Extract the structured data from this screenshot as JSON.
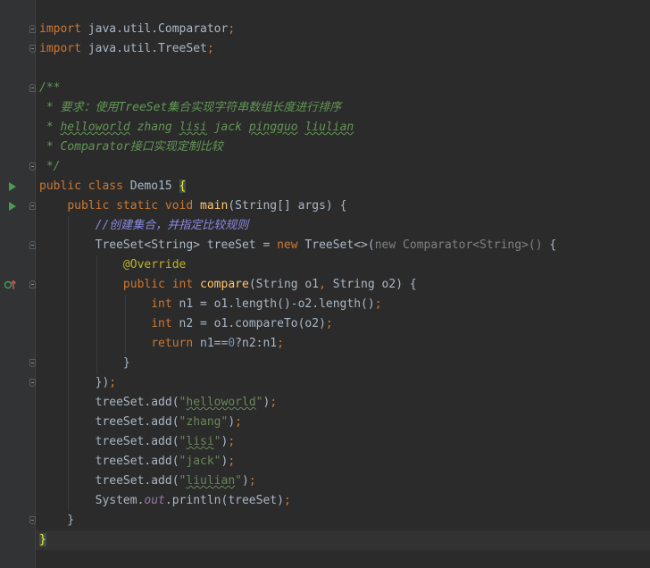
{
  "code_lines": [
    {
      "parts": [
        {
          "t": "import",
          "c": "kw"
        },
        {
          "t": " java.util.Comparator"
        },
        {
          "t": ";",
          "c": "kw"
        }
      ]
    },
    {
      "parts": [
        {
          "t": "import",
          "c": "kw"
        },
        {
          "t": " java.util.TreeSet"
        },
        {
          "t": ";",
          "c": "kw"
        }
      ]
    },
    {
      "parts": []
    },
    {
      "parts": [
        {
          "t": "/**",
          "c": "doc"
        }
      ]
    },
    {
      "parts": [
        {
          "t": " * 要求：使用TreeSet集合实现字符串数组长度进行排序",
          "c": "doc"
        }
      ]
    },
    {
      "parts": [
        {
          "t": " * ",
          "c": "doc"
        },
        {
          "t": "helloworld",
          "c": "doc typo-doc"
        },
        {
          "t": " zhang ",
          "c": "doc"
        },
        {
          "t": "lisi",
          "c": "doc typo-doc"
        },
        {
          "t": " jack ",
          "c": "doc"
        },
        {
          "t": "pingguo",
          "c": "doc typo-doc"
        },
        {
          "t": " ",
          "c": "doc"
        },
        {
          "t": "liulian",
          "c": "doc typo-doc"
        }
      ]
    },
    {
      "parts": [
        {
          "t": " * Comparator接口实现定制比较",
          "c": "doc"
        }
      ]
    },
    {
      "parts": [
        {
          "t": " */",
          "c": "doc"
        }
      ]
    },
    {
      "parts": [
        {
          "t": "public class ",
          "c": "kw"
        },
        {
          "t": "Demo15 "
        },
        {
          "t": "{",
          "c": "brace-hl"
        }
      ]
    },
    {
      "parts": [
        {
          "t": "    "
        },
        {
          "t": "public static void ",
          "c": "kw"
        },
        {
          "t": "main",
          "c": "fn"
        },
        {
          "t": "(String[] args) {"
        }
      ]
    },
    {
      "parts": [
        {
          "t": "        "
        },
        {
          "t": "//创建集合，并指定比较规则",
          "c": "linecmt"
        }
      ]
    },
    {
      "parts": [
        {
          "t": "        TreeSet<String> treeSet = "
        },
        {
          "t": "new ",
          "c": "kw"
        },
        {
          "t": "TreeSet<>("
        },
        {
          "t": "new Comparator<String>()",
          "c": "gray"
        },
        {
          "t": " {"
        }
      ]
    },
    {
      "parts": [
        {
          "t": "            "
        },
        {
          "t": "@Override",
          "c": "ann"
        }
      ]
    },
    {
      "parts": [
        {
          "t": "            "
        },
        {
          "t": "public int ",
          "c": "kw"
        },
        {
          "t": "compare",
          "c": "fn"
        },
        {
          "t": "(String o1"
        },
        {
          "t": ", ",
          "c": "kw"
        },
        {
          "t": "String o2) {"
        }
      ]
    },
    {
      "parts": [
        {
          "t": "                "
        },
        {
          "t": "int ",
          "c": "kw"
        },
        {
          "t": "n1 = o1.length()-o2.length()"
        },
        {
          "t": ";",
          "c": "kw"
        }
      ]
    },
    {
      "parts": [
        {
          "t": "                "
        },
        {
          "t": "int ",
          "c": "kw"
        },
        {
          "t": "n2 = o1.compareTo(o2)"
        },
        {
          "t": ";",
          "c": "kw"
        }
      ]
    },
    {
      "parts": [
        {
          "t": "                "
        },
        {
          "t": "return ",
          "c": "kw"
        },
        {
          "t": "n1=="
        },
        {
          "t": "0",
          "c": "num"
        },
        {
          "t": "?n2:n1"
        },
        {
          "t": ";",
          "c": "kw"
        }
      ]
    },
    {
      "parts": [
        {
          "t": "            }"
        }
      ]
    },
    {
      "parts": [
        {
          "t": "        })"
        },
        {
          "t": ";",
          "c": "kw"
        }
      ]
    },
    {
      "parts": [
        {
          "t": "        treeSet.add("
        },
        {
          "t": "\"",
          "c": "str"
        },
        {
          "t": "helloworld",
          "c": "str typo"
        },
        {
          "t": "\"",
          "c": "str"
        },
        {
          "t": ")"
        },
        {
          "t": ";",
          "c": "kw"
        }
      ]
    },
    {
      "parts": [
        {
          "t": "        treeSet.add("
        },
        {
          "t": "\"zhang\"",
          "c": "str"
        },
        {
          "t": ")"
        },
        {
          "t": ";",
          "c": "kw"
        }
      ]
    },
    {
      "parts": [
        {
          "t": "        treeSet.add("
        },
        {
          "t": "\"",
          "c": "str"
        },
        {
          "t": "lisi",
          "c": "str typo"
        },
        {
          "t": "\"",
          "c": "str"
        },
        {
          "t": ")"
        },
        {
          "t": ";",
          "c": "kw"
        }
      ]
    },
    {
      "parts": [
        {
          "t": "        treeSet.add("
        },
        {
          "t": "\"jack\"",
          "c": "str"
        },
        {
          "t": ")"
        },
        {
          "t": ";",
          "c": "kw"
        }
      ]
    },
    {
      "parts": [
        {
          "t": "        treeSet.add("
        },
        {
          "t": "\"",
          "c": "str"
        },
        {
          "t": "liulian",
          "c": "str typo"
        },
        {
          "t": "\"",
          "c": "str"
        },
        {
          "t": ")"
        },
        {
          "t": ";",
          "c": "kw"
        }
      ]
    },
    {
      "parts": [
        {
          "t": "        System."
        },
        {
          "t": "out",
          "c": "static-field"
        },
        {
          "t": ".println(treeSet)"
        },
        {
          "t": ";",
          "c": "kw"
        }
      ]
    },
    {
      "parts": [
        {
          "t": "    }"
        }
      ]
    },
    {
      "parts": [
        {
          "t": "}",
          "c": "brace-hl"
        }
      ]
    }
  ],
  "gutter": {
    "run_icons": [
      "run-class-icon",
      "run-main-icon"
    ],
    "override_icon": "implements-override-icon"
  },
  "colors": {
    "background": "#2b2b2b",
    "keyword": "#cc7832",
    "string": "#6a8759",
    "function": "#ffc66d",
    "annotation": "#bbb529",
    "doc_comment": "#629755",
    "line_comment": "#8a89de"
  }
}
